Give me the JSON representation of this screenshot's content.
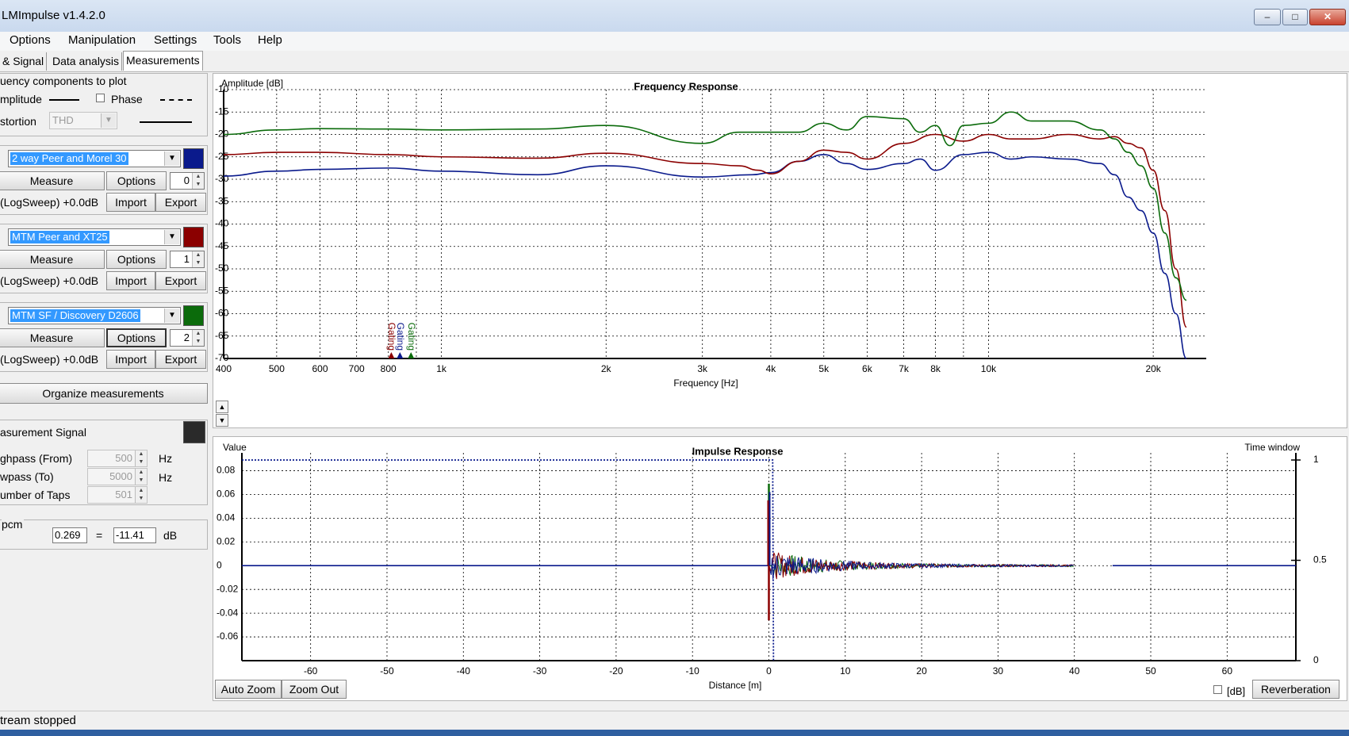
{
  "window": {
    "title": "LMImpulse  v1.4.2.0",
    "minimize_glyph": "–",
    "maximize_glyph": "□",
    "close_glyph": "✕"
  },
  "menu": [
    "Options",
    "Manipulation",
    "Settings",
    "Tools",
    "Help"
  ],
  "tabs": [
    {
      "label": "& Signal",
      "active": false
    },
    {
      "label": "Data analysis",
      "active": false
    },
    {
      "label": "Measurements",
      "active": true
    }
  ],
  "components": {
    "heading": "uency components to plot",
    "amplitude_label": "mplitude",
    "phase_label": "Phase",
    "distortion_label": "stortion",
    "distortion_value": "THD"
  },
  "measurements": [
    {
      "name": "2 way Peer and Morel 30",
      "color": "#0a1a8c",
      "measure": "Measure",
      "options": "Options",
      "index": "0",
      "signal": "(LogSweep) +0.0dB",
      "import": "Import",
      "export": "Export"
    },
    {
      "name": "MTM Peer and XT25",
      "color": "#8b0000",
      "measure": "Measure",
      "options": "Options",
      "index": "1",
      "signal": "(LogSweep) +0.0dB",
      "import": "Import",
      "export": "Export"
    },
    {
      "name": "MTM SF / Discovery D2606",
      "color": "#0b6b0b",
      "measure": "Measure",
      "options": "Options",
      "index": "2",
      "signal": "(LogSweep) +0.0dB",
      "import": "Import",
      "export": "Export"
    }
  ],
  "organize_button": "Organize measurements",
  "signal": {
    "label": "asurement Signal",
    "highpass_label": "ghpass (From)",
    "highpass_value": "500",
    "lowpass_label": "wpass (To)",
    "lowpass_value": "5000",
    "taps_label": "umber of Taps",
    "taps_value": "501",
    "hz": "Hz"
  },
  "level": {
    "label": "pcm",
    "value": "0.269",
    "equals": "=",
    "db_value": "-11.41",
    "db": "dB"
  },
  "fr_chart": {
    "title": "Frequency Response",
    "ylabel": "Amplitude [dB]",
    "xlabel": "Frequency [Hz]",
    "yticks": [
      "-10",
      "-15",
      "-20",
      "-25",
      "-30",
      "-35",
      "-40",
      "-45",
      "-50",
      "-55",
      "-60",
      "-65",
      "-70"
    ],
    "xticks": [
      "400",
      "500",
      "600",
      "700",
      "800",
      "1k",
      "2k",
      "3k",
      "4k",
      "5k",
      "6k",
      "7k",
      "8k",
      "10k",
      "20k"
    ],
    "gating_label": "Gating"
  },
  "ir_chart": {
    "title": "Impulse Response",
    "ylabel": "Value",
    "y2label": "Time window",
    "xlabel": "Distance [m]",
    "yticks": [
      "0.08",
      "0.06",
      "0.04",
      "0.02",
      "0",
      "-0.02",
      "-0.04",
      "-0.06"
    ],
    "xticks": [
      "-60",
      "-50",
      "-40",
      "-30",
      "-20",
      "-10",
      "0",
      "10",
      "20",
      "30",
      "40",
      "50",
      "60"
    ],
    "y2ticks": [
      "1",
      "0.5",
      "0"
    ],
    "auto_zoom": "Auto Zoom",
    "zoom_out": "Zoom Out",
    "db_label": "[dB]",
    "reverberation": "Reverberation"
  },
  "chart_data": [
    {
      "type": "line",
      "title": "Frequency Response",
      "xlabel": "Frequency [Hz]",
      "ylabel": "Amplitude [dB]",
      "xscale": "log",
      "xlim": [
        400,
        25000
      ],
      "ylim": [
        -70,
        -10
      ],
      "grid": true,
      "series": [
        {
          "name": "2 way Peer and Morel 30",
          "color": "#0a1a8c",
          "x": [
            400,
            500,
            600,
            800,
            1000,
            1500,
            2000,
            3000,
            3700,
            4000,
            4500,
            5000,
            5500,
            6000,
            7000,
            7500,
            8000,
            9000,
            10000,
            11000,
            12000,
            14000,
            16000,
            17000,
            18000,
            19000,
            20000,
            21000,
            22000,
            23000
          ],
          "y": [
            -29.3,
            -28.2,
            -27.8,
            -27.5,
            -28.2,
            -29,
            -27,
            -29.5,
            -29,
            -28.5,
            -26,
            -24.5,
            -26.5,
            -27.8,
            -26.5,
            -25.5,
            -28,
            -24.5,
            -24,
            -25.5,
            -25,
            -25.5,
            -26.5,
            -29,
            -34,
            -37,
            -42,
            -51,
            -60,
            -70
          ]
        },
        {
          "name": "MTM Peer and XT25",
          "color": "#8b0000",
          "x": [
            400,
            500,
            600,
            800,
            1000,
            1500,
            2000,
            3000,
            3500,
            3800,
            4000,
            4500,
            5000,
            5500,
            6000,
            7000,
            8000,
            9000,
            10000,
            11000,
            12000,
            14000,
            16000,
            17000,
            18000,
            19000,
            20000,
            21000,
            22000,
            23000
          ],
          "y": [
            -24.5,
            -24,
            -24,
            -24.5,
            -25,
            -25.3,
            -24.2,
            -26.5,
            -27,
            -28,
            -28.8,
            -26,
            -23.5,
            -24,
            -25.5,
            -22,
            -20,
            -21.5,
            -20,
            -21,
            -21,
            -20,
            -21,
            -20.5,
            -22,
            -23,
            -28,
            -37,
            -50,
            -63
          ]
        },
        {
          "name": "MTM SF / Discovery D2606",
          "color": "#0b6b0b",
          "x": [
            400,
            500,
            600,
            800,
            1000,
            1500,
            2000,
            3000,
            3500,
            4000,
            4500,
            5000,
            5500,
            6000,
            7000,
            7500,
            8000,
            8500,
            9000,
            10000,
            11000,
            12000,
            14000,
            16000,
            17000,
            18000,
            19000,
            20000,
            21000,
            22000,
            23000
          ],
          "y": [
            -20,
            -19,
            -18.7,
            -18.8,
            -19,
            -18.8,
            -18,
            -22,
            -19.5,
            -19.5,
            -19.5,
            -17.5,
            -19,
            -16,
            -16.5,
            -19.5,
            -18,
            -22.5,
            -18,
            -17.5,
            -15,
            -17,
            -17,
            -19,
            -21,
            -24,
            -27,
            -32,
            -42,
            -52,
            -57
          ]
        }
      ]
    },
    {
      "type": "line",
      "title": "Impulse Response",
      "xlabel": "Distance [m]",
      "ylabel": "Value",
      "y2label": "Time window",
      "xlim": [
        -69,
        69
      ],
      "ylim": [
        -0.08,
        0.095
      ],
      "y2lim": [
        0,
        1
      ],
      "grid": true,
      "impulse": {
        "peak_position": 0,
        "peak_values": {
          "green": 0.069,
          "blue": 0.062,
          "red": 0.055
        },
        "negative_peak": -0.046,
        "decay_until": 40
      },
      "time_window": {
        "start": -69,
        "end": 0.5,
        "level": 1
      }
    }
  ]
}
